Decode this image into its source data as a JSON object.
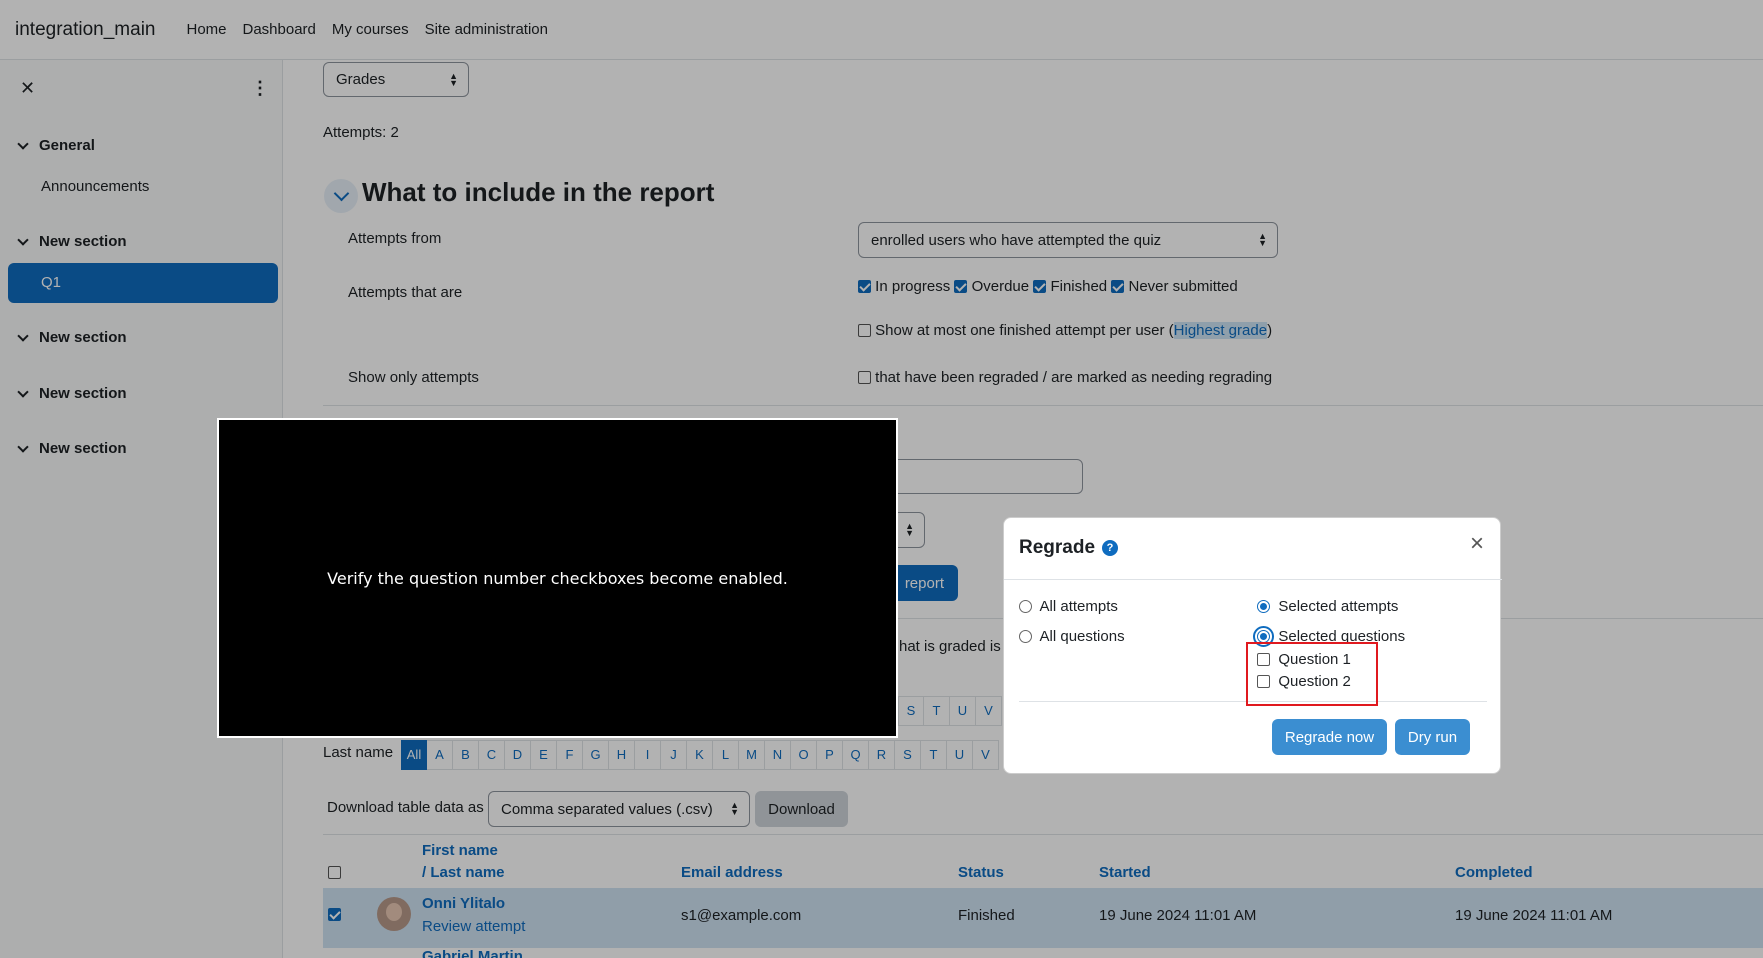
{
  "navbar": {
    "brand": "integration_main",
    "links": [
      "Home",
      "Dashboard",
      "My courses",
      "Site administration"
    ]
  },
  "drawer": {
    "sections": [
      {
        "label": "General"
      },
      {
        "label": "New section"
      },
      {
        "label": "New section"
      },
      {
        "label": "New section"
      },
      {
        "label": "New section"
      }
    ],
    "announcements": "Announcements",
    "active_activity": "Q1"
  },
  "report": {
    "grades_select": "Grades",
    "attempts_count": "Attempts: 2",
    "section_heading": "What to include in the report",
    "attempts_from_label": "Attempts from",
    "attempts_from_value": "enrolled users who have attempted the quiz",
    "attempts_that_are_label": "Attempts that are",
    "states": [
      "In progress",
      "Overdue",
      "Finished",
      "Never submitted"
    ],
    "one_attempt_pre": "Show at most one finished attempt per user (",
    "one_attempt_link": "Highest grade",
    "one_attempt_post": ")",
    "show_only_label": "Show only attempts",
    "regraded_option": "that have been regraded / are marked as needing regrading",
    "show_report_partial": "report",
    "graded_partial": "hat is graded is",
    "last_name_label": "Last name",
    "letters_all": "All",
    "letters": [
      "A",
      "B",
      "C",
      "D",
      "E",
      "F",
      "G",
      "H",
      "I",
      "J",
      "K",
      "L",
      "M",
      "N",
      "O",
      "P",
      "Q",
      "R",
      "S",
      "T",
      "U",
      "V"
    ],
    "letters_partial_row": [
      "S",
      "T",
      "U",
      "V"
    ],
    "download_label": "Download table data as",
    "download_format": "Comma separated values (.csv)",
    "download_button": "Download"
  },
  "table": {
    "headers": {
      "first_name": "First name",
      "last_name": "/ Last name",
      "email": "Email address",
      "status": "Status",
      "started": "Started",
      "completed": "Completed"
    },
    "rows": [
      {
        "name": "Onni Ylitalo",
        "review": "Review attempt",
        "email": "s1@example.com",
        "status": "Finished",
        "started": "19 June 2024 11:01 AM",
        "completed": "19 June 2024 11:01 AM"
      },
      {
        "name": "Gabriel Martin"
      }
    ]
  },
  "dialog": {
    "title": "Regrade",
    "help_icon": "?",
    "close": "×",
    "all_attempts": "All attempts",
    "selected_attempts": "Selected attempts",
    "all_questions": "All questions",
    "selected_questions": "Selected questions",
    "question_1": "Question 1",
    "question_2": "Question 2",
    "regrade_now": "Regrade now",
    "dry_run": "Dry run"
  },
  "caption": "Verify the question number checkboxes become enabled."
}
